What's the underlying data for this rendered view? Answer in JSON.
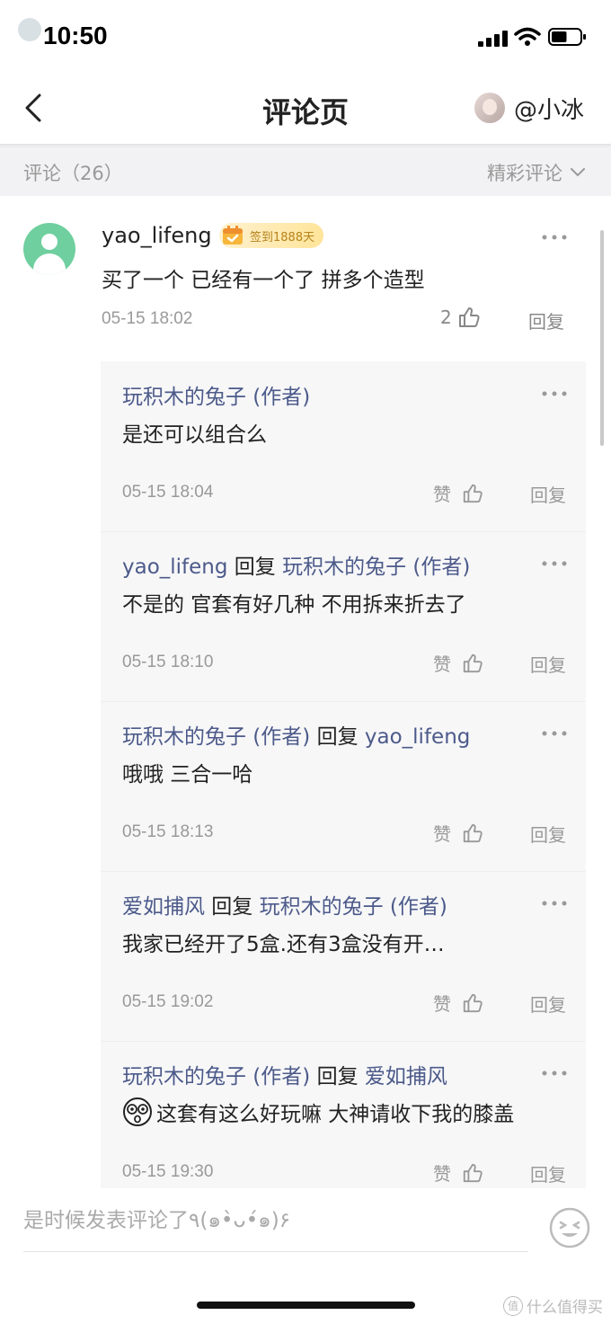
{
  "status_bar": {
    "time": "10:50",
    "battery_level": 0.55
  },
  "nav": {
    "title": "评论页",
    "user_name": "@小冰"
  },
  "comments_header": {
    "count_label": "评论（26）",
    "sort_label": "精彩评论"
  },
  "main_comment": {
    "user": "yao_lifeng",
    "badge": "签到1888天",
    "text": "买了一个 已经有一个了 拼多个造型",
    "time": "05-15 18:02",
    "likes": "2",
    "reply_label": "回复"
  },
  "replies": [
    {
      "user": "玩积木的兔子 (作者)",
      "mid": "",
      "target": "",
      "text": "是还可以组合么",
      "time": "05-15 18:04",
      "like_label": "赞",
      "reply_label": "回复"
    },
    {
      "user": "yao_lifeng",
      "mid": " 回复 ",
      "target": "玩积木的兔子 (作者)",
      "text": "不是的 官套有好几种 不用拆来折去了",
      "time": "05-15 18:10",
      "like_label": "赞",
      "reply_label": "回复"
    },
    {
      "user": "玩积木的兔子 (作者)",
      "mid": " 回复 ",
      "target": "yao_lifeng",
      "text": "哦哦 三合一哈",
      "time": "05-15 18:13",
      "like_label": "赞",
      "reply_label": "回复"
    },
    {
      "user": "爱如捕风",
      "mid": " 回复 ",
      "target": "玩积木的兔子 (作者)",
      "text": "我家已经开了5盒.还有3盒没有开…",
      "time": "05-15 19:02",
      "like_label": "赞",
      "reply_label": "回复"
    },
    {
      "user": "玩积木的兔子 (作者)",
      "mid": " 回复 ",
      "target": "爱如捕风",
      "text": "这套有这么好玩嘛 大神请收下我的膝盖",
      "time": "05-15 19:30",
      "like_label": "赞",
      "reply_label": "回复"
    }
  ],
  "bottom": {
    "placeholder": "是时候发表评论了٩(๑•̀ᴗ•́๑)۶",
    "watermark": "什么值得买"
  },
  "colors": {
    "accent_name": "#4c5a8a",
    "avatar_green": "#6fcf9f",
    "strip_bg": "#f2f2f4"
  }
}
